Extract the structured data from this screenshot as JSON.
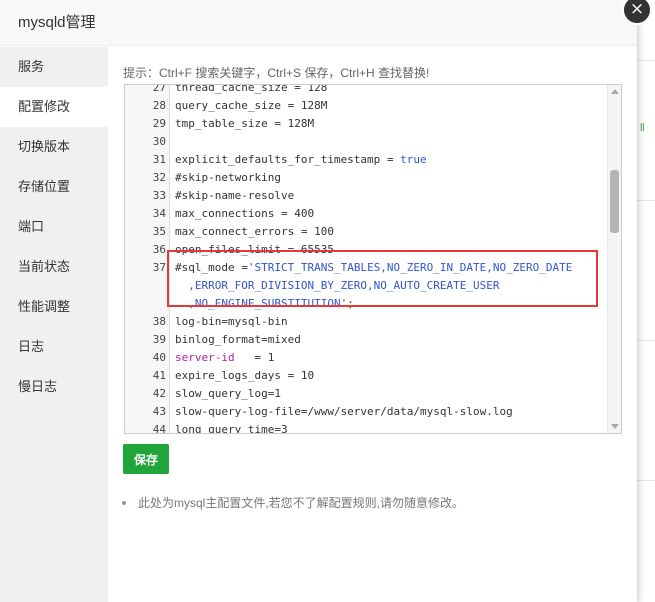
{
  "modal": {
    "title": "mysqld管理",
    "close_label": "×"
  },
  "sidebar": {
    "items": [
      {
        "label": "服务"
      },
      {
        "label": "配置修改",
        "active": true
      },
      {
        "label": "切换版本"
      },
      {
        "label": "存储位置"
      },
      {
        "label": "端口"
      },
      {
        "label": "当前状态"
      },
      {
        "label": "性能调整"
      },
      {
        "label": "日志"
      },
      {
        "label": "慢日志"
      }
    ]
  },
  "hint": "提示：Ctrl+F 搜索关键字，Ctrl+S 保存，Ctrl+H 查找替换!",
  "editor": {
    "lines": [
      {
        "num": "27",
        "segments": [
          {
            "t": "thread_cache_size = 128",
            "c": ""
          }
        ]
      },
      {
        "num": "28",
        "segments": [
          {
            "t": "query_cache_size = 128M",
            "c": ""
          }
        ]
      },
      {
        "num": "29",
        "segments": [
          {
            "t": "tmp_table_size = 128M",
            "c": ""
          }
        ]
      },
      {
        "num": "30",
        "segments": [
          {
            "t": "",
            "c": ""
          }
        ]
      },
      {
        "num": "31",
        "segments": [
          {
            "t": "explicit_defaults_for_timestamp = ",
            "c": ""
          },
          {
            "t": "true",
            "c": "kw"
          }
        ]
      },
      {
        "num": "32",
        "segments": [
          {
            "t": "#skip-networking",
            "c": ""
          }
        ]
      },
      {
        "num": "33",
        "segments": [
          {
            "t": "#skip-name-resolve",
            "c": ""
          }
        ]
      },
      {
        "num": "34",
        "segments": [
          {
            "t": "max_connections = 400",
            "c": ""
          }
        ]
      },
      {
        "num": "35",
        "segments": [
          {
            "t": "max_connect_errors = 100",
            "c": ""
          }
        ]
      },
      {
        "num": "36",
        "segments": [
          {
            "t": "open_files_limit = 65535",
            "c": ""
          }
        ]
      },
      {
        "num": "37",
        "segments": [
          {
            "t": "#sql_mode =",
            "c": ""
          },
          {
            "t": "'STRICT_TRANS_TABLES,NO_ZERO_IN_DATE,NO_ZERO_DATE",
            "c": "kw"
          }
        ]
      },
      {
        "num": "",
        "segments": [
          {
            "t": "  ,ERROR_FOR_DIVISION_BY_ZERO,NO_AUTO_CREATE_USER",
            "c": "kw"
          }
        ]
      },
      {
        "num": "",
        "segments": [
          {
            "t": "  ,NO_ENGINE_SUBSTITUTION'",
            "c": "kw"
          },
          {
            "t": ";",
            "c": ""
          }
        ]
      },
      {
        "num": "38",
        "segments": [
          {
            "t": "log-bin=mysql-bin",
            "c": ""
          }
        ]
      },
      {
        "num": "39",
        "segments": [
          {
            "t": "binlog_format=mixed",
            "c": ""
          }
        ]
      },
      {
        "num": "40",
        "segments": [
          {
            "t": "server-id",
            "c": "attr"
          },
          {
            "t": "   = 1",
            "c": ""
          }
        ]
      },
      {
        "num": "41",
        "segments": [
          {
            "t": "expire_logs_days = 10",
            "c": ""
          }
        ]
      },
      {
        "num": "42",
        "segments": [
          {
            "t": "slow_query_log=1",
            "c": ""
          }
        ]
      },
      {
        "num": "43",
        "segments": [
          {
            "t": "slow-query-log-file=/www/server/data/mysql-slow.log",
            "c": ""
          }
        ]
      },
      {
        "num": "44",
        "segments": [
          {
            "t": "long_query_time=3",
            "c": ""
          }
        ]
      }
    ]
  },
  "save_button": "保存",
  "note": "此处为mysql主配置文件,若您不了解配置规则,请勿随意修改。",
  "colors": {
    "accent": "#20a53a",
    "highlight": "#e53935"
  }
}
